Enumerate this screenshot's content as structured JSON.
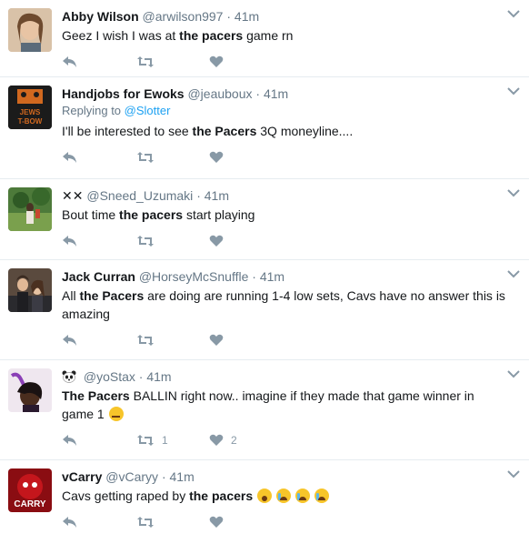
{
  "tweets": [
    {
      "name": "Abby Wilson",
      "handle": "@arwilson997",
      "dot": "·",
      "time": "41m",
      "text_before": "Geez I wish I was at ",
      "text_bold": "the pacers",
      "text_after": " game rn",
      "retweet_count": "",
      "like_count": ""
    },
    {
      "name": "Handjobs for Ewoks",
      "handle": "@jeauboux",
      "dot": "·",
      "time": "41m",
      "replying_label": "Replying to",
      "replying_mention": "@Slotter",
      "text_before": "I'll be interested to see ",
      "text_bold": "the Pacers",
      "text_after": " 3Q moneyline....",
      "avatar_text_1": "JEWS",
      "avatar_text_2": "T-BOW"
    },
    {
      "name_emoji": "✕✕",
      "handle": "@Sneed_Uzumaki",
      "dot": "·",
      "time": "41m",
      "text_before": "Bout time ",
      "text_bold": "the pacers",
      "text_after": " start playing"
    },
    {
      "name": "Jack Curran",
      "handle": "@HorseyMcSnuffle",
      "dot": "·",
      "time": "41m",
      "text_before": "All ",
      "text_bold": "the Pacers",
      "text_after": " are doing are running 1-4 low sets, Cavs have no answer this is amazing"
    },
    {
      "handle": "@yoStax",
      "dot": "·",
      "time": "41m",
      "text_bold": "The Pacers",
      "text_after": " BALLIN right now.. imagine if they made that game winner in game 1",
      "retweet_count": "1",
      "like_count": "2"
    },
    {
      "name": "vCarry",
      "handle": "@vCaryy",
      "dot": "·",
      "time": "41m",
      "text_before": "Cavs getting raped by ",
      "text_bold": "the pacers",
      "text_after": " ",
      "avatar_text": "CARRY"
    }
  ],
  "colors": {
    "border": "#e6ecf0",
    "muted": "#657786",
    "icon": "#8899a6",
    "link": "#1da1f2"
  },
  "icons": [
    "reply-icon",
    "retweet-icon",
    "like-icon",
    "caret-down-icon",
    "panda-icon",
    "emoji-thinking",
    "emoji-scream",
    "emoji-crying"
  ]
}
